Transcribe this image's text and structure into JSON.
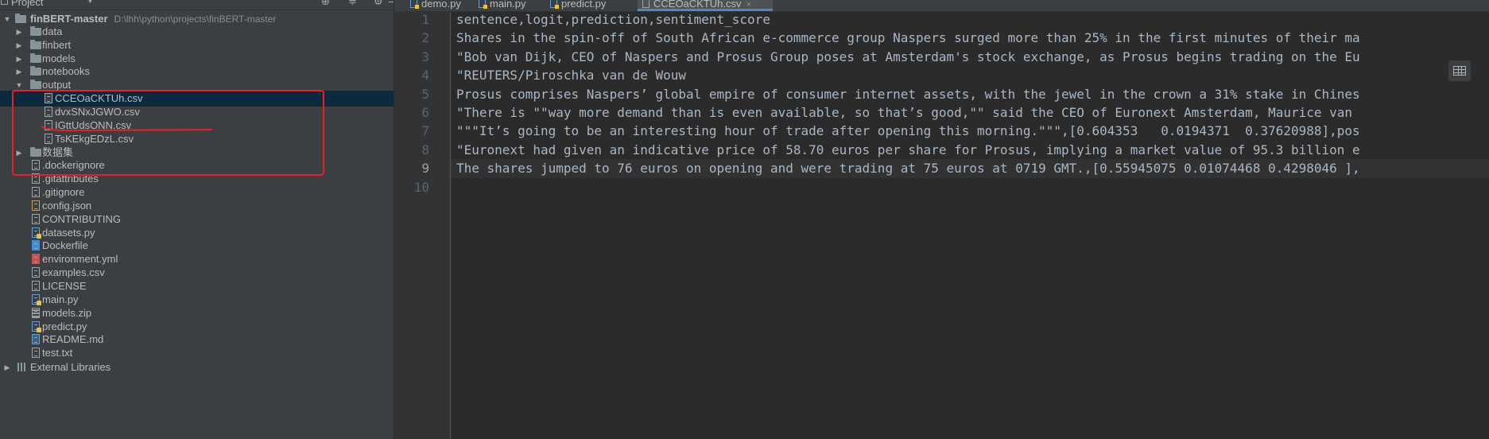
{
  "project_panel": {
    "title": "Project",
    "root": {
      "name": "finBERT-master",
      "path": "D:\\lhh\\python\\projects\\finBERT-master"
    },
    "items": [
      {
        "label": "data",
        "type": "folder",
        "depth": 1,
        "expanded": false
      },
      {
        "label": "finbert",
        "type": "folder",
        "depth": 1,
        "expanded": false
      },
      {
        "label": "models",
        "type": "folder",
        "depth": 1,
        "expanded": false
      },
      {
        "label": "notebooks",
        "type": "folder",
        "depth": 1,
        "expanded": false
      },
      {
        "label": "output",
        "type": "folder",
        "depth": 1,
        "expanded": true
      },
      {
        "label": "CCEOaCKTUh.csv",
        "type": "csv",
        "depth": 2,
        "selected": true
      },
      {
        "label": "dvxSNxJGWO.csv",
        "type": "csv",
        "depth": 2
      },
      {
        "label": "IGttUdsONN.csv",
        "type": "csv",
        "depth": 2
      },
      {
        "label": "TsKEkgEDzL.csv",
        "type": "csv",
        "depth": 2
      },
      {
        "label": "数据集",
        "type": "folder",
        "depth": 1,
        "expanded": false
      },
      {
        "label": ".dockerignore",
        "type": "git",
        "depth": 1
      },
      {
        "label": ".gitattributes",
        "type": "git",
        "depth": 1
      },
      {
        "label": ".gitignore",
        "type": "git",
        "depth": 1
      },
      {
        "label": "config.json",
        "type": "json",
        "depth": 1
      },
      {
        "label": "CONTRIBUTING",
        "type": "text",
        "depth": 1
      },
      {
        "label": "datasets.py",
        "type": "py",
        "depth": 1
      },
      {
        "label": "Dockerfile",
        "type": "docker",
        "depth": 1
      },
      {
        "label": "environment.yml",
        "type": "yml",
        "depth": 1
      },
      {
        "label": "examples.csv",
        "type": "csv",
        "depth": 1
      },
      {
        "label": "LICENSE",
        "type": "text",
        "depth": 1
      },
      {
        "label": "main.py",
        "type": "py",
        "depth": 1
      },
      {
        "label": "models.zip",
        "type": "zip",
        "depth": 1
      },
      {
        "label": "predict.py",
        "type": "py",
        "depth": 1
      },
      {
        "label": "README.md",
        "type": "md",
        "depth": 1
      },
      {
        "label": "test.txt",
        "type": "text",
        "depth": 1
      }
    ],
    "external_libraries": "External Libraries"
  },
  "tabs": [
    {
      "label": "demo.py",
      "icon": "py",
      "active": false
    },
    {
      "label": "main.py",
      "icon": "py",
      "active": false
    },
    {
      "label": "predict.py",
      "icon": "py",
      "active": false
    },
    {
      "label": "CCEOaCKTUh.csv",
      "icon": "csv",
      "active": true,
      "close": "×"
    }
  ],
  "editor": {
    "current_line": 9,
    "lines": [
      "sentence,logit,prediction,sentiment_score",
      "Shares in the spin-off of South African e-commerce group Naspers surged more than 25% in the first minutes of their ma",
      "\"Bob van Dijk, CEO of Naspers and Prosus Group poses at Amsterdam's stock exchange, as Prosus begins trading on the Eu",
      "\"REUTERS/Piroschka van de Wouw",
      "Prosus comprises Naspers’ global empire of consumer internet assets, with the jewel in the crown a 31% stake in Chines",
      "\"There is \"\"way more demand than is even available, so that’s good,\"\" said the CEO of Euronext Amsterdam, Maurice van",
      "\"\"\"It’s going to be an interesting hour of trade after opening this morning.\"\"\",[0.604353   0.0194371  0.37620988],pos",
      "\"Euronext had given an indicative price of 58.70 euros per share for Prosus, implying a market value of 95.3 billion e",
      "The shares jumped to 76 euros on opening and were trading at 75 euros at 0719 GMT.,[0.55945075 0.01074468 0.4298046 ],",
      ""
    ],
    "line_numbers": [
      "1",
      "2",
      "3",
      "4",
      "5",
      "6",
      "7",
      "8",
      "9",
      "10"
    ]
  },
  "colors": {
    "panel_bg": "#3c3f41",
    "editor_bg": "#2b2b2b",
    "selection": "#0d293e",
    "annotation_red": "#e8202a",
    "code_text": "#a9b7c6"
  }
}
